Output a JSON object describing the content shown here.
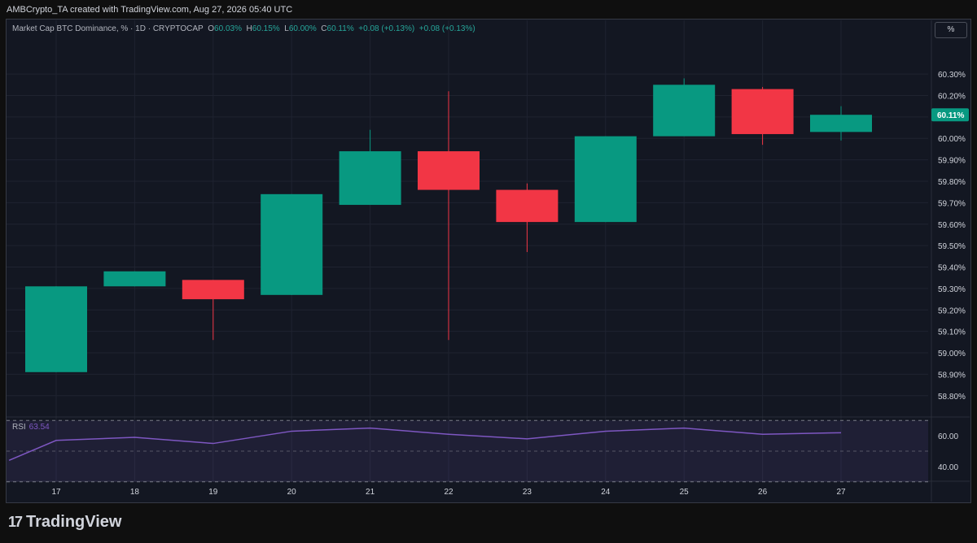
{
  "header": {
    "attribution": "AMBCrypto_TA created with TradingView.com, Aug 27, 2026 05:40 UTC"
  },
  "legend": {
    "symbol": "Market Cap BTC Dominance, % · 1D · CRYPTOCAP",
    "o_label": "O",
    "o_value": "60.03%",
    "h_label": "H",
    "h_value": "60.15%",
    "l_label": "L",
    "l_value": "60.00%",
    "c_label": "C",
    "c_value": "60.11%",
    "change1": "+0.08 (+0.13%)",
    "change2": "+0.08 (+0.13%)"
  },
  "scale_button": "%",
  "rsi": {
    "label": "RSI",
    "value": "63.54"
  },
  "footer": {
    "logo_glyph": "17",
    "brand": "TradingView"
  },
  "colors": {
    "up": "#089981",
    "down": "#f23645",
    "rsi_line": "#7e57c2",
    "background": "#131722"
  },
  "chart_data": {
    "type": "candlestick",
    "categories": [
      "17",
      "18",
      "19",
      "20",
      "21",
      "22",
      "23",
      "24",
      "25",
      "26",
      "27"
    ],
    "series": [
      {
        "open": [
          58.91,
          59.31,
          59.34,
          59.27,
          59.69,
          59.94,
          59.76,
          59.61,
          60.01,
          60.23,
          60.03
        ],
        "high": [
          59.31,
          59.38,
          59.34,
          59.74,
          60.04,
          60.22,
          59.79,
          60.01,
          60.28,
          60.24,
          60.15
        ],
        "low": [
          58.91,
          59.31,
          59.06,
          59.27,
          59.69,
          59.06,
          59.47,
          59.61,
          60.01,
          59.97,
          59.99
        ],
        "close": [
          59.31,
          59.38,
          59.25,
          59.74,
          59.94,
          59.76,
          59.61,
          60.01,
          60.25,
          60.02,
          60.11
        ]
      }
    ],
    "y_ticks": [
      "60.30%",
      "60.20%",
      "60.10%",
      "60.00%",
      "59.90%",
      "59.80%",
      "59.70%",
      "59.60%",
      "59.50%",
      "59.40%",
      "59.30%",
      "59.20%",
      "59.10%",
      "59.00%",
      "58.90%",
      "58.80%"
    ],
    "y_tick_values": [
      60.3,
      60.2,
      60.1,
      60.0,
      59.9,
      59.8,
      59.7,
      59.6,
      59.5,
      59.4,
      59.3,
      59.2,
      59.1,
      59.0,
      58.9,
      58.8
    ],
    "ylim": [
      58.75,
      60.38
    ],
    "last_price_label": "60.11%",
    "last_price": 60.11,
    "rsi": {
      "values": [
        44,
        57,
        59,
        55,
        63,
        65,
        61,
        58,
        63,
        65,
        61,
        62
      ],
      "x": [
        16.4,
        17,
        18,
        19,
        20,
        21,
        22,
        23,
        24,
        25,
        26,
        27
      ],
      "ylim": [
        32,
        68
      ],
      "band": [
        30,
        70
      ],
      "y_ticks": [
        "60.00",
        "40.00"
      ],
      "y_tick_values": [
        60,
        40
      ]
    },
    "grid": true
  }
}
